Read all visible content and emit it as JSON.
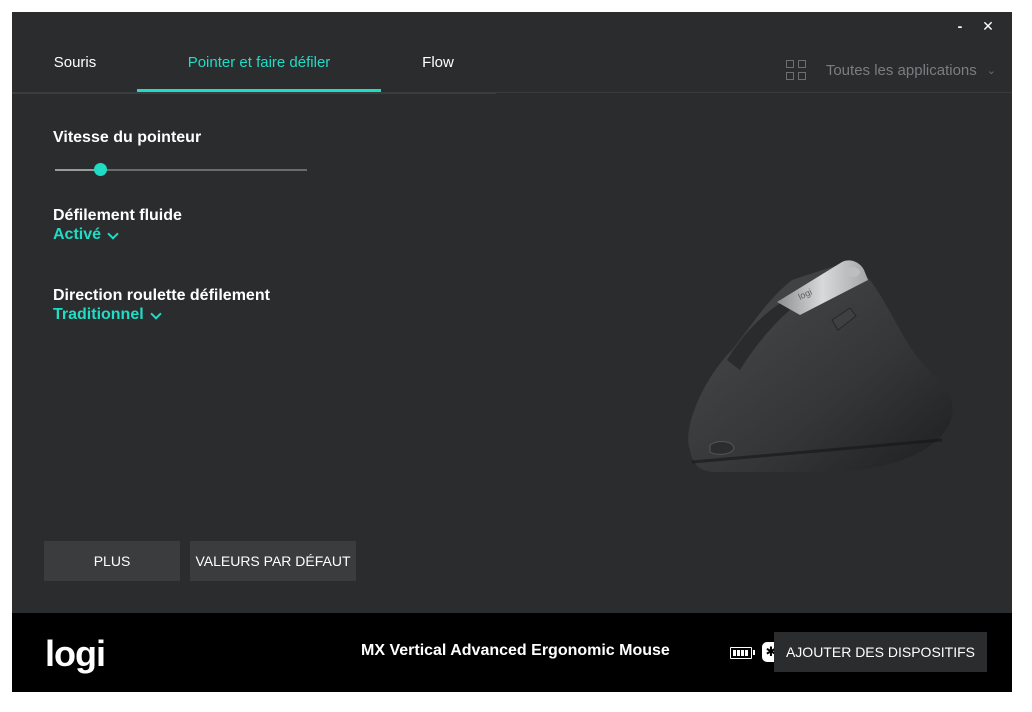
{
  "window": {
    "minimize_label": "-",
    "close_label": "✕"
  },
  "tabs": [
    {
      "label": "Souris",
      "active": false
    },
    {
      "label": "Pointer et faire défiler",
      "active": true
    },
    {
      "label": "Flow",
      "active": false
    }
  ],
  "app_filter": {
    "icon": "grid-icon",
    "label": "Toutes les applications",
    "chevron": "⌄"
  },
  "settings": {
    "pointer_speed": {
      "label": "Vitesse du pointeur",
      "value_fraction": 0.18
    },
    "smooth_scrolling": {
      "label": "Défilement fluide",
      "value": "Activé"
    },
    "scroll_direction": {
      "label": "Direction roulette défilement",
      "value": "Traditionnel"
    }
  },
  "buttons": {
    "more": "PLUS",
    "defaults": "VALEURS PAR DÉFAUT"
  },
  "footer": {
    "logo": "logi",
    "device_name": "MX Vertical Advanced Ergonomic Mouse",
    "bluetooth_symbol": "✱",
    "add_devices": "AJOUTER DES DISPOSITIFS"
  },
  "mouse_logo": "logi",
  "colors": {
    "accent": "#1fdcc5",
    "background": "#2b2c2e",
    "footer": "#000000",
    "button": "#3b3c3e"
  }
}
